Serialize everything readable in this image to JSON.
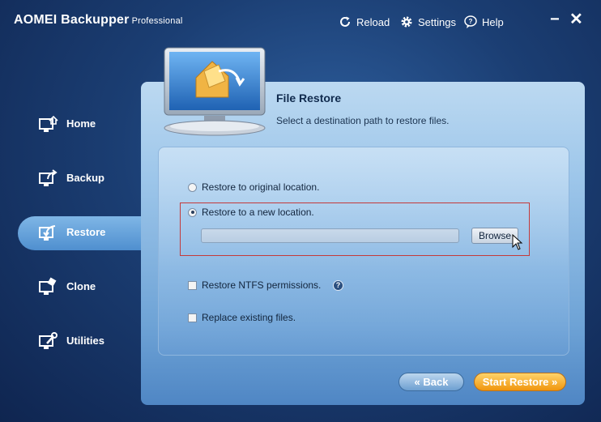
{
  "app": {
    "title": "AOMEI Backupper",
    "edition": "Professional"
  },
  "toolbar": {
    "reload_label": "Reload",
    "settings_label": "Settings",
    "help_label": "Help",
    "minimize_label": "−",
    "close_label": "✕"
  },
  "sidebar": {
    "items": [
      {
        "label": "Home",
        "icon": "home-icon"
      },
      {
        "label": "Backup",
        "icon": "backup-icon"
      },
      {
        "label": "Restore",
        "icon": "restore-icon",
        "active": true
      },
      {
        "label": "Clone",
        "icon": "clone-icon"
      },
      {
        "label": "Utilities",
        "icon": "utilities-icon"
      }
    ]
  },
  "main": {
    "title": "File Restore",
    "subtitle": "Select a destination path to restore files."
  },
  "options": {
    "original_location": {
      "label": "Restore to original location.",
      "checked": false
    },
    "new_location": {
      "label": "Restore to a new location.",
      "checked": true
    },
    "path_value": "",
    "browse_label": "Browse",
    "ntfs": {
      "label": "Restore NTFS permissions.",
      "checked": false
    },
    "replace": {
      "label": "Replace existing files.",
      "checked": false
    },
    "help_glyph": "?"
  },
  "footer": {
    "back_label": "« Back",
    "start_label": "Start Restore »"
  },
  "colors": {
    "background": "#1b3e73",
    "panel": "#9dc6ea",
    "highlight": "#c43a3a",
    "start_button": "#f0960e"
  }
}
